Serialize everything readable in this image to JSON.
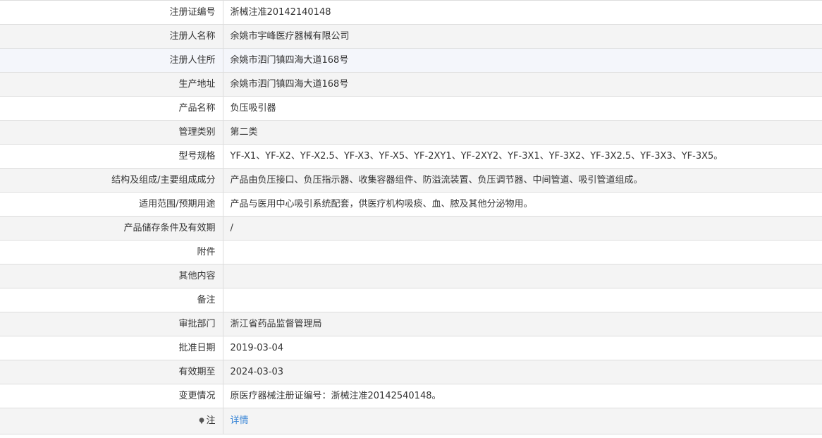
{
  "record": {
    "rows": [
      {
        "label": "注册证编号",
        "value": "浙械注准20142140148"
      },
      {
        "label": "注册人名称",
        "value": "余姚市宇峰医疗器械有限公司"
      },
      {
        "label": "注册人住所",
        "value": "余姚市泗门镇四海大道168号"
      },
      {
        "label": "生产地址",
        "value": "余姚市泗门镇四海大道168号"
      },
      {
        "label": "产品名称",
        "value": "负压吸引器"
      },
      {
        "label": "管理类别",
        "value": "第二类"
      },
      {
        "label": "型号规格",
        "value": "YF-X1、YF-X2、YF-X2.5、YF-X3、YF-X5、YF-2XY1、YF-2XY2、YF-3X1、YF-3X2、YF-3X2.5、YF-3X3、YF-3X5。"
      },
      {
        "label": "结构及组成/主要组成成分",
        "value": "产品由负压接口、负压指示器、收集容器组件、防溢流装置、负压调节器、中间管道、吸引管道组成。"
      },
      {
        "label": "适用范围/预期用途",
        "value": "产品与医用中心吸引系统配套，供医疗机构吸痰、血、脓及其他分泌物用。"
      },
      {
        "label": "产品储存条件及有效期",
        "value": "/"
      },
      {
        "label": "附件",
        "value": ""
      },
      {
        "label": "其他内容",
        "value": ""
      },
      {
        "label": "备注",
        "value": ""
      },
      {
        "label": "审批部门",
        "value": "浙江省药品监督管理局"
      },
      {
        "label": "批准日期",
        "value": "2019-03-04"
      },
      {
        "label": "有效期至",
        "value": "2024-03-03"
      },
      {
        "label": "变更情况",
        "value": "原医疗器械注册证编号：浙械注准20142540148。"
      }
    ],
    "note": {
      "label": "注",
      "icon": "note-icon",
      "link_text": "详情",
      "link_color": "#3583d6"
    }
  },
  "colors": {
    "border": "#dddddd",
    "zebra_bg": "#f4f4f4",
    "highlight_bg": "#f4f6fb",
    "text": "#333333"
  }
}
